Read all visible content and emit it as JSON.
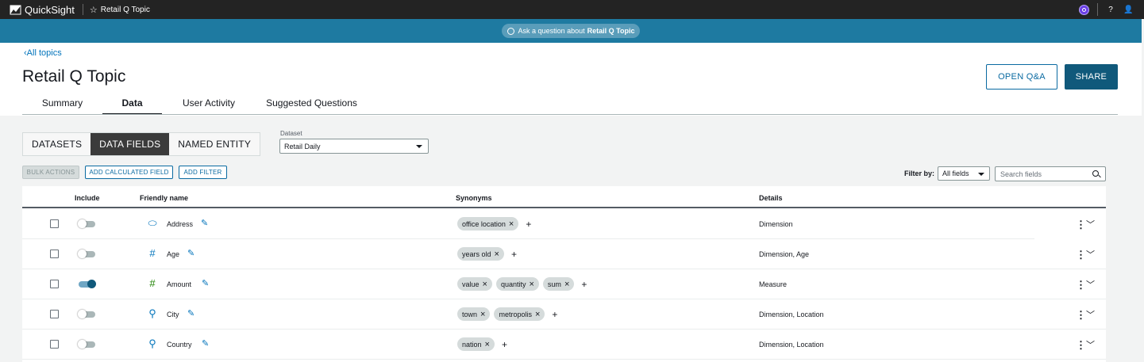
{
  "topbar": {
    "app_name": "QuickSight",
    "topic_crumb": "Retail Q Topic",
    "icons": [
      "quicksight-logo-icon",
      "star-icon",
      "account-badge-icon",
      "help-icon",
      "user-icon"
    ],
    "help_glyph": "?",
    "user_glyph": "👤"
  },
  "askbar": {
    "prefix": "Ask a question about",
    "topic": "Retail Q Topic"
  },
  "header": {
    "back_link": "All topics",
    "title": "Retail Q Topic",
    "open_qa_label": "OPEN Q&A",
    "share_label": "SHARE",
    "tabs": [
      {
        "label": "Summary",
        "active": false
      },
      {
        "label": "Data",
        "active": true
      },
      {
        "label": "User Activity",
        "active": false
      },
      {
        "label": "Suggested Questions",
        "active": false
      }
    ]
  },
  "segmented": {
    "items": [
      {
        "label": "DATASETS",
        "active": false
      },
      {
        "label": "DATA FIELDS",
        "active": true
      },
      {
        "label": "NAMED ENTITY",
        "active": false
      }
    ]
  },
  "dataset": {
    "label": "Dataset",
    "value": "Retail Daily"
  },
  "actions": {
    "bulk": "BULK ACTIONS",
    "add_calculated": "ADD CALCULATED FIELD",
    "add_filter": "ADD FILTER"
  },
  "filter": {
    "label": "Filter by:",
    "value": "All fields",
    "search_placeholder": "Search fields"
  },
  "table": {
    "headers": {
      "include": "Include",
      "friendly_name": "Friendly name",
      "synonyms": "Synonyms",
      "details": "Details"
    },
    "rows": [
      {
        "name": "Address",
        "icon": "text-field-icon",
        "glyph": "⬭",
        "included": false,
        "synonyms": [
          "office location"
        ],
        "details": "Dimension"
      },
      {
        "name": "Age",
        "icon": "number-field-icon",
        "glyph": "#",
        "included": false,
        "synonyms": [
          "years old"
        ],
        "details": "Dimension, Age"
      },
      {
        "name": "Amount",
        "icon": "measure-field-icon",
        "glyph": "#",
        "included": true,
        "synonyms": [
          "value",
          "quantity",
          "sum"
        ],
        "details": "Measure"
      },
      {
        "name": "City",
        "icon": "location-field-icon",
        "glyph": "⚲",
        "included": false,
        "synonyms": [
          "town",
          "metropolis"
        ],
        "details": "Dimension, Location"
      },
      {
        "name": "Country",
        "icon": "location-field-icon",
        "glyph": "⚲",
        "included": false,
        "synonyms": [
          "nation"
        ],
        "details": "Dimension, Location"
      }
    ]
  },
  "colors": {
    "accent": "#0a6aa1",
    "askbar": "#1e7aa1",
    "share": "#10597b",
    "measure": "#1d8102"
  }
}
